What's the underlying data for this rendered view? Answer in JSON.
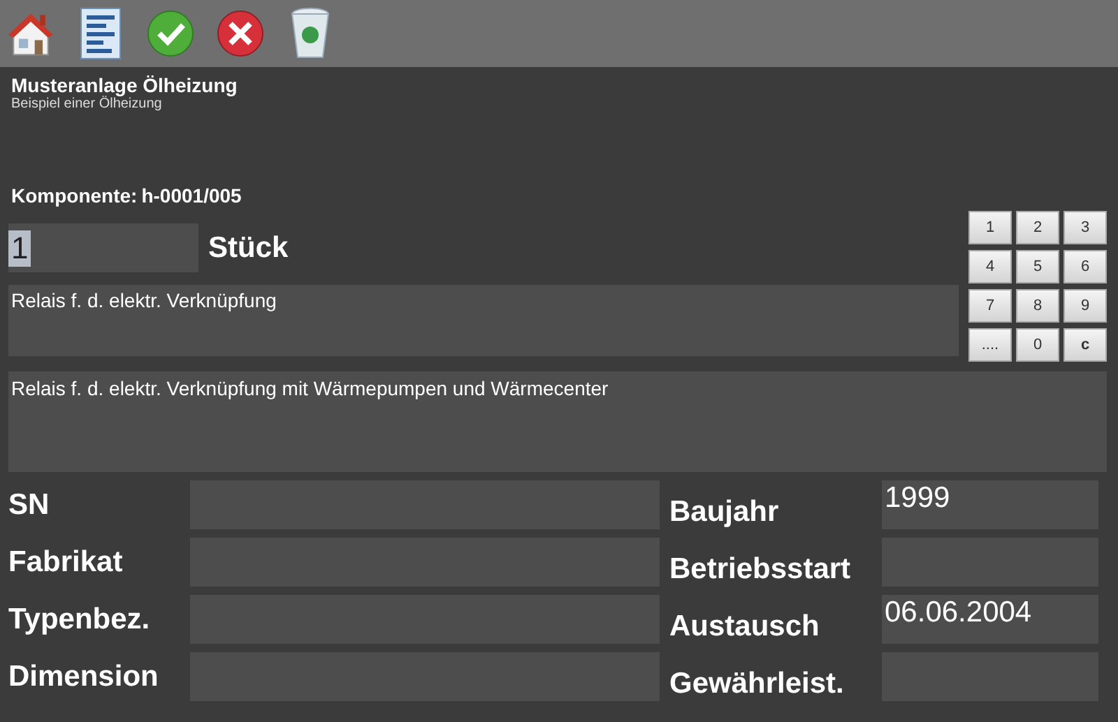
{
  "toolbar": {
    "buttons": [
      {
        "kind": "home"
      },
      {
        "kind": "form"
      },
      {
        "kind": "ok"
      },
      {
        "kind": "cancel"
      },
      {
        "kind": "trash"
      }
    ]
  },
  "header": {
    "title": "Musteranlage Ölheizung",
    "subtitle": "Beispiel einer Ölheizung"
  },
  "component": {
    "label": "Komponente:",
    "value": "h-0001/005"
  },
  "quantity": {
    "value": "1",
    "selected": true,
    "unit": "Stück"
  },
  "short_description": {
    "value": "Relais f. d. elektr. Verknüpfung"
  },
  "long_description": {
    "value": "Relais f. d. elektr. Verknüpfung mit Wärmepumpen und Wärmecenter"
  },
  "keypad": {
    "keys": [
      {
        "label": "1"
      },
      {
        "label": "2"
      },
      {
        "label": "3"
      },
      {
        "label": "4"
      },
      {
        "label": "5"
      },
      {
        "label": "6"
      },
      {
        "label": "7"
      },
      {
        "label": "8"
      },
      {
        "label": "9"
      },
      {
        "label": "...."
      },
      {
        "label": "0"
      },
      {
        "label": "c"
      }
    ]
  },
  "fields_left": [
    {
      "label": "SN"
    },
    {
      "label": "Fabrikat"
    },
    {
      "label": "Typenbez."
    },
    {
      "label": "Dimension"
    }
  ],
  "fields_right": [
    {
      "label": "Baujahr",
      "value": "1999"
    },
    {
      "label": "Betriebsstart"
    },
    {
      "label": "Austausch",
      "value": "06.06.2004"
    },
    {
      "label": "Gewährleist."
    }
  ]
}
